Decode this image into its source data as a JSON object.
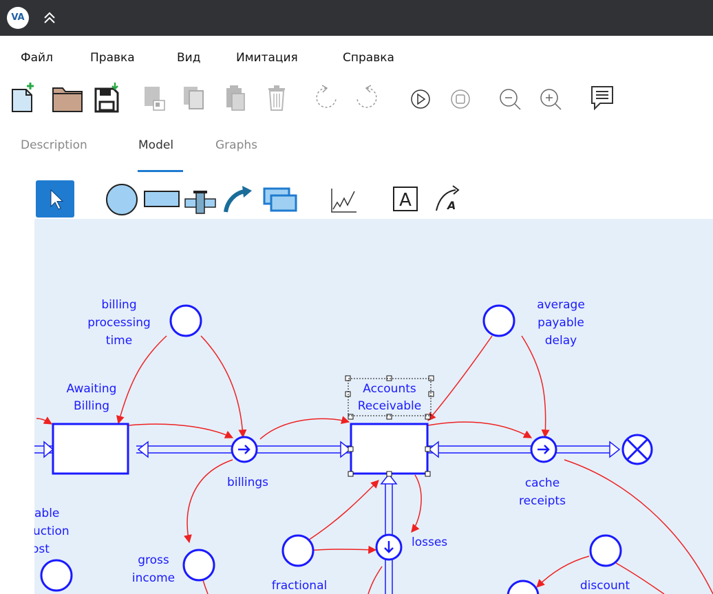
{
  "app": {
    "logo_text": "VA"
  },
  "menu": {
    "file": "Файл",
    "edit": "Правка",
    "view": "Вид",
    "simulation": "Имитация",
    "help": "Справка"
  },
  "tabs": {
    "description": "Description",
    "model": "Model",
    "graphs": "Graphs",
    "active": "Model"
  },
  "toolbar_icons": [
    "new-file-icon",
    "open-folder-icon",
    "save-icon",
    "copy-icon",
    "duplicate-icon",
    "paste-icon",
    "delete-icon",
    "undo-icon",
    "redo-icon",
    "play-icon",
    "stop-icon",
    "zoom-out-icon",
    "zoom-in-icon",
    "comment-icon"
  ],
  "palette_icons": [
    "select-pointer-icon",
    "variable-circle-icon",
    "stock-rectangle-icon",
    "flow-valve-icon",
    "link-arrow-icon",
    "module-icon",
    "graph-icon",
    "text-icon",
    "annotation-icon"
  ],
  "colors": {
    "canvas_bg": "#e5eff9",
    "node_stroke": "#1a1aff",
    "link": "#ee2222",
    "titlebar": "#303236",
    "accent": "#1f7bd0"
  },
  "diagram": {
    "labels": {
      "billing_processing_time": [
        "billing",
        "processing",
        "time"
      ],
      "awaiting_billing": [
        "Awaiting",
        "Billing"
      ],
      "billings": [
        "billings"
      ],
      "accounts_receivable": [
        "Accounts",
        "Receivable"
      ],
      "average_payable_delay": [
        "average",
        "payable",
        "delay"
      ],
      "cache_receipts": [
        "cache",
        "receipts"
      ],
      "losses": [
        "losses"
      ],
      "gross_income": [
        "gross",
        "income"
      ],
      "fractional": [
        "fractional"
      ],
      "discount": [
        "discount"
      ],
      "partial_left": [
        "able",
        "uction",
        "ost"
      ]
    }
  }
}
